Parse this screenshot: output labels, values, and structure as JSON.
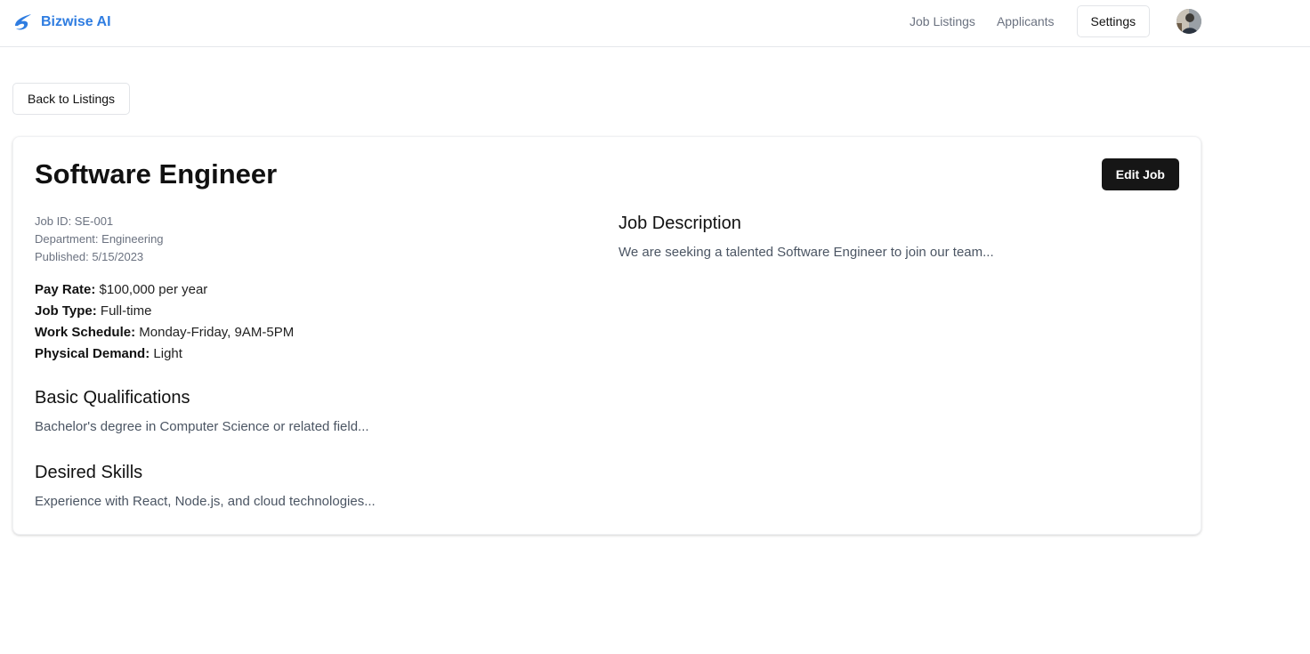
{
  "brand": {
    "name": "Bizwise AI",
    "icon": "bizwise-logo-icon",
    "color": "#2f7de1"
  },
  "nav": {
    "job_listings": "Job Listings",
    "applicants": "Applicants",
    "settings": "Settings"
  },
  "back_label": "Back to Listings",
  "job": {
    "title": "Software Engineer",
    "edit_label": "Edit Job",
    "id_line": "Job ID: SE-001",
    "department_line": "Department: Engineering",
    "published_line": "Published: 5/15/2023",
    "pay_rate_label": "Pay Rate:",
    "pay_rate_value": "$100,000 per year",
    "job_type_label": "Job Type:",
    "job_type_value": "Full-time",
    "schedule_label": "Work Schedule:",
    "schedule_value": "Monday-Friday, 9AM-5PM",
    "physical_label": "Physical Demand:",
    "physical_value": "Light",
    "qualifications_heading": "Basic Qualifications",
    "qualifications_text": "Bachelor's degree in Computer Science or related field...",
    "skills_heading": "Desired Skills",
    "skills_text": "Experience with React, Node.js, and cloud technologies...",
    "description_heading": "Job Description",
    "description_text": "We are seeking a talented Software Engineer to join our team..."
  },
  "colors": {
    "primary_button": "#161616",
    "muted_text": "#6b7280"
  }
}
